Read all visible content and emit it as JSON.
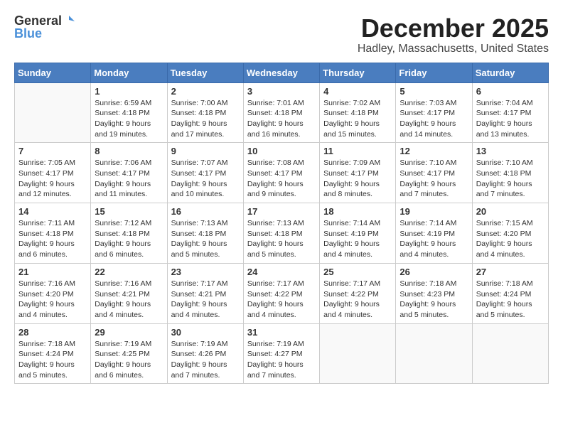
{
  "header": {
    "logo_general": "General",
    "logo_blue": "Blue",
    "month_title": "December 2025",
    "location": "Hadley, Massachusetts, United States"
  },
  "weekdays": [
    "Sunday",
    "Monday",
    "Tuesday",
    "Wednesday",
    "Thursday",
    "Friday",
    "Saturday"
  ],
  "weeks": [
    [
      {
        "day": "",
        "info": ""
      },
      {
        "day": "1",
        "info": "Sunrise: 6:59 AM\nSunset: 4:18 PM\nDaylight: 9 hours\nand 19 minutes."
      },
      {
        "day": "2",
        "info": "Sunrise: 7:00 AM\nSunset: 4:18 PM\nDaylight: 9 hours\nand 17 minutes."
      },
      {
        "day": "3",
        "info": "Sunrise: 7:01 AM\nSunset: 4:18 PM\nDaylight: 9 hours\nand 16 minutes."
      },
      {
        "day": "4",
        "info": "Sunrise: 7:02 AM\nSunset: 4:18 PM\nDaylight: 9 hours\nand 15 minutes."
      },
      {
        "day": "5",
        "info": "Sunrise: 7:03 AM\nSunset: 4:17 PM\nDaylight: 9 hours\nand 14 minutes."
      },
      {
        "day": "6",
        "info": "Sunrise: 7:04 AM\nSunset: 4:17 PM\nDaylight: 9 hours\nand 13 minutes."
      }
    ],
    [
      {
        "day": "7",
        "info": "Sunrise: 7:05 AM\nSunset: 4:17 PM\nDaylight: 9 hours\nand 12 minutes."
      },
      {
        "day": "8",
        "info": "Sunrise: 7:06 AM\nSunset: 4:17 PM\nDaylight: 9 hours\nand 11 minutes."
      },
      {
        "day": "9",
        "info": "Sunrise: 7:07 AM\nSunset: 4:17 PM\nDaylight: 9 hours\nand 10 minutes."
      },
      {
        "day": "10",
        "info": "Sunrise: 7:08 AM\nSunset: 4:17 PM\nDaylight: 9 hours\nand 9 minutes."
      },
      {
        "day": "11",
        "info": "Sunrise: 7:09 AM\nSunset: 4:17 PM\nDaylight: 9 hours\nand 8 minutes."
      },
      {
        "day": "12",
        "info": "Sunrise: 7:10 AM\nSunset: 4:17 PM\nDaylight: 9 hours\nand 7 minutes."
      },
      {
        "day": "13",
        "info": "Sunrise: 7:10 AM\nSunset: 4:18 PM\nDaylight: 9 hours\nand 7 minutes."
      }
    ],
    [
      {
        "day": "14",
        "info": "Sunrise: 7:11 AM\nSunset: 4:18 PM\nDaylight: 9 hours\nand 6 minutes."
      },
      {
        "day": "15",
        "info": "Sunrise: 7:12 AM\nSunset: 4:18 PM\nDaylight: 9 hours\nand 6 minutes."
      },
      {
        "day": "16",
        "info": "Sunrise: 7:13 AM\nSunset: 4:18 PM\nDaylight: 9 hours\nand 5 minutes."
      },
      {
        "day": "17",
        "info": "Sunrise: 7:13 AM\nSunset: 4:18 PM\nDaylight: 9 hours\nand 5 minutes."
      },
      {
        "day": "18",
        "info": "Sunrise: 7:14 AM\nSunset: 4:19 PM\nDaylight: 9 hours\nand 4 minutes."
      },
      {
        "day": "19",
        "info": "Sunrise: 7:14 AM\nSunset: 4:19 PM\nDaylight: 9 hours\nand 4 minutes."
      },
      {
        "day": "20",
        "info": "Sunrise: 7:15 AM\nSunset: 4:20 PM\nDaylight: 9 hours\nand 4 minutes."
      }
    ],
    [
      {
        "day": "21",
        "info": "Sunrise: 7:16 AM\nSunset: 4:20 PM\nDaylight: 9 hours\nand 4 minutes."
      },
      {
        "day": "22",
        "info": "Sunrise: 7:16 AM\nSunset: 4:21 PM\nDaylight: 9 hours\nand 4 minutes."
      },
      {
        "day": "23",
        "info": "Sunrise: 7:17 AM\nSunset: 4:21 PM\nDaylight: 9 hours\nand 4 minutes."
      },
      {
        "day": "24",
        "info": "Sunrise: 7:17 AM\nSunset: 4:22 PM\nDaylight: 9 hours\nand 4 minutes."
      },
      {
        "day": "25",
        "info": "Sunrise: 7:17 AM\nSunset: 4:22 PM\nDaylight: 9 hours\nand 4 minutes."
      },
      {
        "day": "26",
        "info": "Sunrise: 7:18 AM\nSunset: 4:23 PM\nDaylight: 9 hours\nand 5 minutes."
      },
      {
        "day": "27",
        "info": "Sunrise: 7:18 AM\nSunset: 4:24 PM\nDaylight: 9 hours\nand 5 minutes."
      }
    ],
    [
      {
        "day": "28",
        "info": "Sunrise: 7:18 AM\nSunset: 4:24 PM\nDaylight: 9 hours\nand 5 minutes."
      },
      {
        "day": "29",
        "info": "Sunrise: 7:19 AM\nSunset: 4:25 PM\nDaylight: 9 hours\nand 6 minutes."
      },
      {
        "day": "30",
        "info": "Sunrise: 7:19 AM\nSunset: 4:26 PM\nDaylight: 9 hours\nand 7 minutes."
      },
      {
        "day": "31",
        "info": "Sunrise: 7:19 AM\nSunset: 4:27 PM\nDaylight: 9 hours\nand 7 minutes."
      },
      {
        "day": "",
        "info": ""
      },
      {
        "day": "",
        "info": ""
      },
      {
        "day": "",
        "info": ""
      }
    ]
  ]
}
